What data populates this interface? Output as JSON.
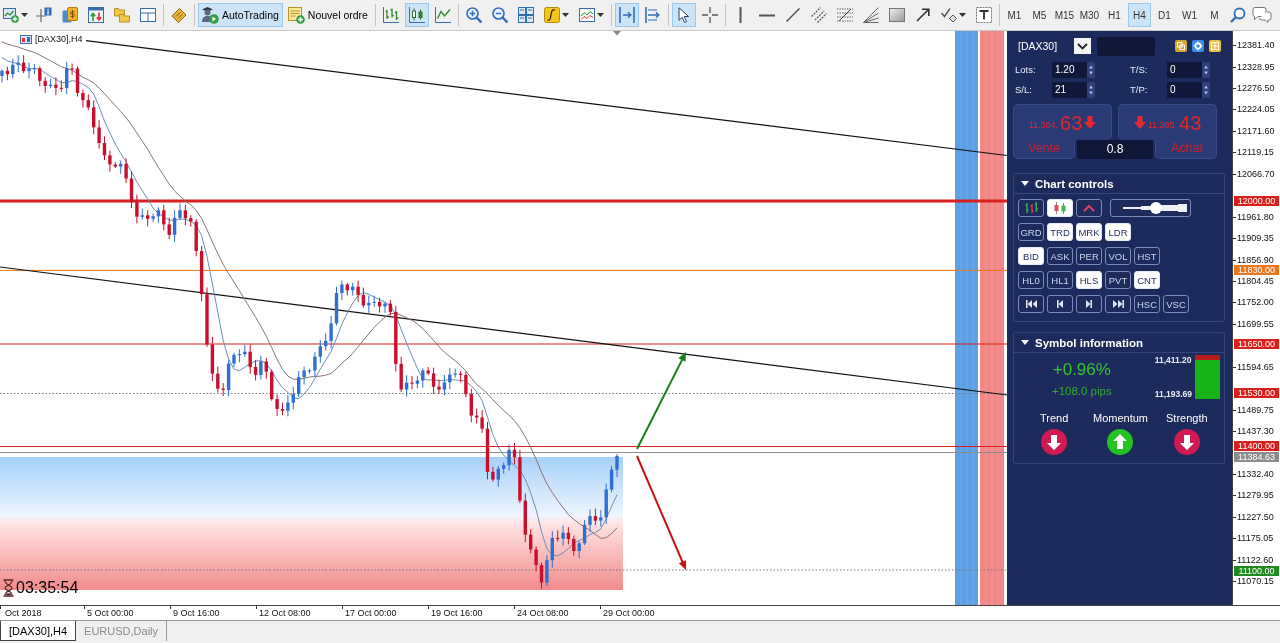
{
  "toolbar": {
    "actions": [
      {
        "label": "AutoTrading",
        "pressed": true
      },
      {
        "label": "Nouvel ordre",
        "pressed": false
      }
    ],
    "chart_types": [
      {
        "selected": false
      },
      {
        "selected": true
      },
      {
        "selected": false
      }
    ],
    "chart_shift": {
      "pressed": true
    },
    "auto_scroll": {
      "pressed": false
    },
    "cursor_modes": [
      {
        "selected": true
      },
      {
        "selected": false
      }
    ],
    "timeframes": [
      {
        "label": "M1",
        "selected": false
      },
      {
        "label": "M5",
        "selected": false
      },
      {
        "label": "M15",
        "selected": false
      },
      {
        "label": "M30",
        "selected": false
      },
      {
        "label": "H1",
        "selected": false
      },
      {
        "label": "H4",
        "selected": true
      },
      {
        "label": "D1",
        "selected": false
      },
      {
        "label": "W1",
        "selected": false
      },
      {
        "label": "M",
        "selected": false
      }
    ]
  },
  "chart": {
    "title": "[DAX30],H4",
    "timer": "03:35:54",
    "price_scale": [
      "12381.40",
      "12328.95",
      "12276.50",
      "12224.05",
      "12171.60",
      "12119.15",
      "12066.70",
      "11961.80",
      "11909.35",
      "11856.90",
      "11804.45",
      "11752.00",
      "11699.55",
      "11594.65",
      "11489.75",
      "11437.30",
      "11332.40",
      "11279.95",
      "11227.50",
      "11175.05",
      "11122.60",
      "11070.15"
    ],
    "price_levels": [
      {
        "label": "12000.00",
        "color": "#d8201c"
      },
      {
        "label": "11830.00",
        "color": "#e8771f"
      },
      {
        "label": "11650.00",
        "color": "#d8201c"
      },
      {
        "label": "11530.00",
        "color": "#d8201c"
      },
      {
        "label": "11400.00",
        "color": "#d8201c"
      },
      {
        "label": "11384.63",
        "color": "#8c8c8c"
      },
      {
        "label": "11100.00",
        "color": "#208a20"
      }
    ],
    "time_scale": [
      "Oct 2018",
      "5 Oct 00:00",
      "9 Oct 16:00",
      "12 Oct 08:00",
      "17 Oct 00:00",
      "19 Oct 16:00",
      "24 Oct 08:00",
      "29 Oct 00:00"
    ]
  },
  "trade_panel": {
    "symbol": "[DAX30]",
    "fields": [
      {
        "label": "Lots:",
        "value": "1.20"
      },
      {
        "label": "T/S:",
        "value": "0"
      },
      {
        "label": "S/L:",
        "value": "21"
      },
      {
        "label": "T/P:",
        "value": "0"
      }
    ],
    "sell": {
      "price": "11,384.",
      "pips": "63",
      "up": false,
      "label": "Vente"
    },
    "buy": {
      "price": "11,385.",
      "pips": "43",
      "up": false,
      "label": "Achat"
    },
    "spread": "0.8"
  },
  "chart_controls": {
    "title": "Chart controls",
    "expanded": true,
    "chart_types": [
      {
        "selected": false
      },
      {
        "selected": true
      },
      {
        "selected": false
      }
    ],
    "zoom": {
      "level": 0.58
    },
    "rows": [
      [
        {
          "kind": "text",
          "label": "GRD",
          "selected": false
        },
        {
          "kind": "text",
          "label": "TRD",
          "selected": true
        },
        {
          "kind": "text",
          "label": "MRK",
          "selected": true
        },
        {
          "kind": "text",
          "label": "LDR",
          "selected": true
        }
      ],
      [
        {
          "kind": "text",
          "label": "BID",
          "selected": true
        },
        {
          "kind": "text",
          "label": "ASK",
          "selected": false
        },
        {
          "kind": "text",
          "label": "PER",
          "selected": false
        },
        {
          "kind": "text",
          "label": "VOL",
          "selected": false
        },
        {
          "kind": "text",
          "label": "HST",
          "selected": false
        }
      ],
      [
        {
          "kind": "text",
          "label": "HL0",
          "selected": false
        },
        {
          "kind": "text",
          "label": "HL1",
          "selected": false
        },
        {
          "kind": "text",
          "label": "HLS",
          "selected": true
        },
        {
          "kind": "text",
          "label": "PVT",
          "selected": false
        },
        {
          "kind": "text",
          "label": "CNT",
          "selected": true
        }
      ],
      [
        {
          "kind": "first"
        },
        {
          "kind": "prev"
        },
        {
          "kind": "next"
        },
        {
          "kind": "last"
        },
        {
          "kind": "text",
          "label": "HSC",
          "selected": false
        },
        {
          "kind": "text",
          "label": "VSC",
          "selected": false
        }
      ]
    ]
  },
  "symbol_info": {
    "title": "Symbol information",
    "expanded": true,
    "change": "+0.96%",
    "pips": "+108.0 pips",
    "high": "11,411.20",
    "low": "11,193.69",
    "range": {
      "level": 0.88
    },
    "indicators": [
      {
        "label": "Trend",
        "up": false
      },
      {
        "label": "Momentum",
        "up": true
      },
      {
        "label": "Strength",
        "up": false
      }
    ]
  },
  "tabs": [
    {
      "label": "[DAX30],H4",
      "selected": true
    },
    {
      "label": "EURUSD,Daily",
      "selected": false
    }
  ]
}
